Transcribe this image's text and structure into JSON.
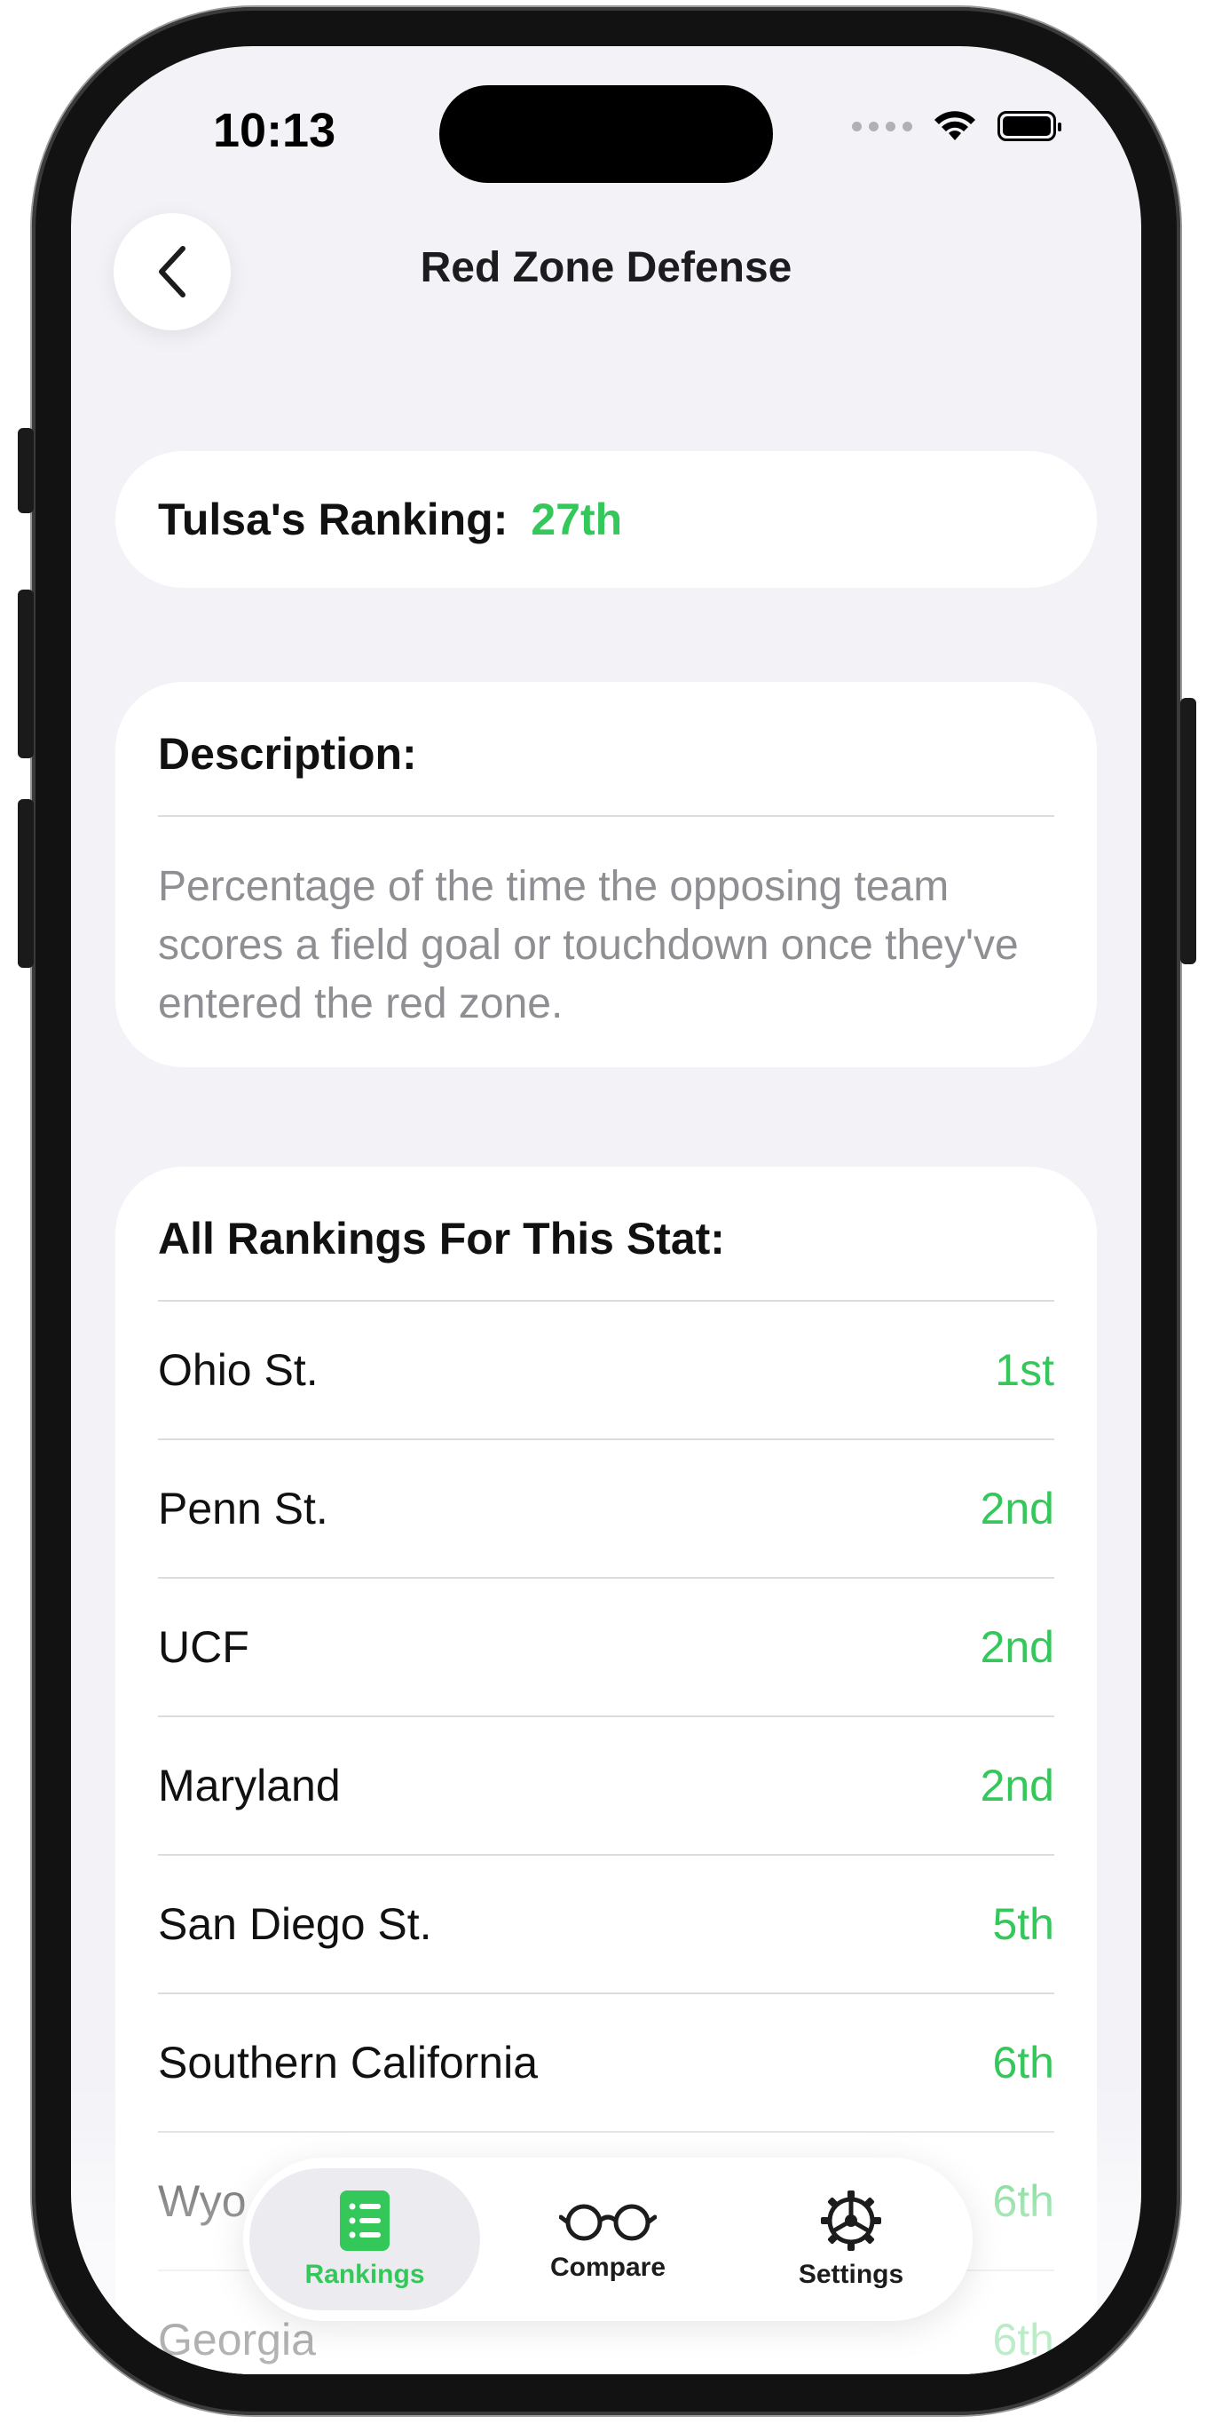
{
  "status_bar": {
    "time": "10:13"
  },
  "nav": {
    "title": "Red Zone Defense",
    "back_icon": "chevron-left-icon"
  },
  "ranking": {
    "label": "Tulsa's Ranking:",
    "value": "27th"
  },
  "description": {
    "heading": "Description:",
    "text": "Percentage of the time the opposing team scores a field goal or touchdown once they've entered the red zone."
  },
  "all_rankings": {
    "heading": "All Rankings For This Stat:",
    "rows": [
      {
        "team": "Ohio St.",
        "rank": "1st"
      },
      {
        "team": "Penn St.",
        "rank": "2nd"
      },
      {
        "team": "UCF",
        "rank": "2nd"
      },
      {
        "team": "Maryland",
        "rank": "2nd"
      },
      {
        "team": "San Diego St.",
        "rank": "5th"
      },
      {
        "team": "Southern California",
        "rank": "6th"
      },
      {
        "team": "Wyo",
        "rank": "6th"
      },
      {
        "team": "Georgia",
        "rank": "6th"
      }
    ]
  },
  "tab_bar": {
    "tabs": [
      {
        "label": "Rankings",
        "icon": "list-icon",
        "active": true
      },
      {
        "label": "Compare",
        "icon": "glasses-icon",
        "active": false
      },
      {
        "label": "Settings",
        "icon": "gear-icon",
        "active": false
      }
    ]
  },
  "colors": {
    "accent": "#34c759",
    "background": "#f2f2f7",
    "secondary_text": "#8e8e93"
  }
}
